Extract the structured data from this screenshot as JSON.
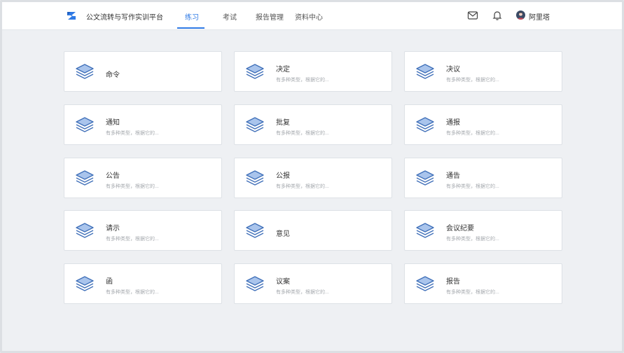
{
  "header": {
    "app_title": "公文流转与写作实训平台",
    "nav": [
      {
        "label": "练习",
        "active": true
      },
      {
        "label": "考试",
        "active": false
      },
      {
        "label": "报告管理",
        "active": false
      },
      {
        "label": "资料中心",
        "active": false
      }
    ],
    "user_name": "阿里塔"
  },
  "colors": {
    "accent": "#2f7ae5",
    "icon_fill": "#a9c4ec",
    "icon_stroke": "#3f6fb8"
  },
  "cards": [
    {
      "title": "命令",
      "desc": ""
    },
    {
      "title": "决定",
      "desc": "有多种类型，根据它的..."
    },
    {
      "title": "决议",
      "desc": "有多种类型，根据它的..."
    },
    {
      "title": "通知",
      "desc": "有多种类型，根据它的..."
    },
    {
      "title": "批复",
      "desc": "有多种类型，根据它的..."
    },
    {
      "title": "通报",
      "desc": "有多种类型，根据它的..."
    },
    {
      "title": "公告",
      "desc": "有多种类型，根据它的..."
    },
    {
      "title": "公报",
      "desc": "有多种类型，根据它的..."
    },
    {
      "title": "通告",
      "desc": "有多种类型，根据它的..."
    },
    {
      "title": "请示",
      "desc": "有多种类型，根据它的..."
    },
    {
      "title": "意见",
      "desc": ""
    },
    {
      "title": "会议纪要",
      "desc": "有多种类型，根据它的..."
    },
    {
      "title": "函",
      "desc": "有多种类型，根据它的..."
    },
    {
      "title": "议案",
      "desc": "有多种类型，根据它的..."
    },
    {
      "title": "报告",
      "desc": "有多种类型，根据它的..."
    }
  ]
}
